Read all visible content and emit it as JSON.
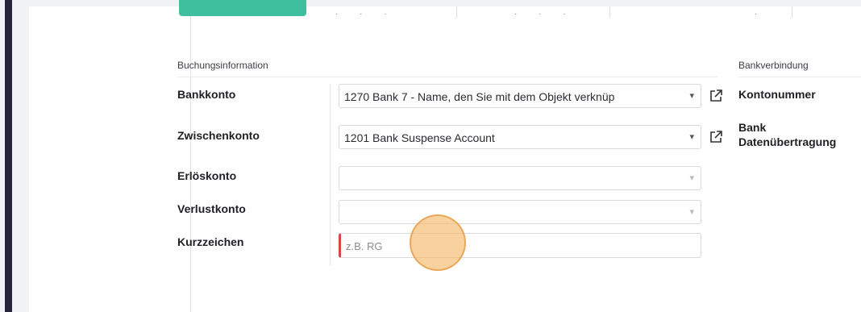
{
  "booking": {
    "section_title": "Buchungsinformation",
    "fields": [
      {
        "label": "Bankkonto",
        "value": "1270 Bank 7 - Name, den Sie mit dem Objekt verknüp"
      },
      {
        "label": "Zwischenkonto",
        "value": "1201 Bank Suspense Account"
      },
      {
        "label": "Erlöskonto",
        "value": ""
      },
      {
        "label": "Verlustkonto",
        "value": ""
      },
      {
        "label": "Kurzzeichen",
        "placeholder": "z.B. RG",
        "value": ""
      }
    ]
  },
  "bank": {
    "section_title": "Bankverbindung",
    "labels": [
      "Kontonummer",
      "Bank",
      "Datenübertragung"
    ]
  },
  "icons": {
    "caret": "chevron-down-icon",
    "external": "external-link-icon"
  },
  "colors": {
    "accent": "#3fbf9d",
    "required": "#d64545",
    "cursor": "#f4b86a"
  }
}
